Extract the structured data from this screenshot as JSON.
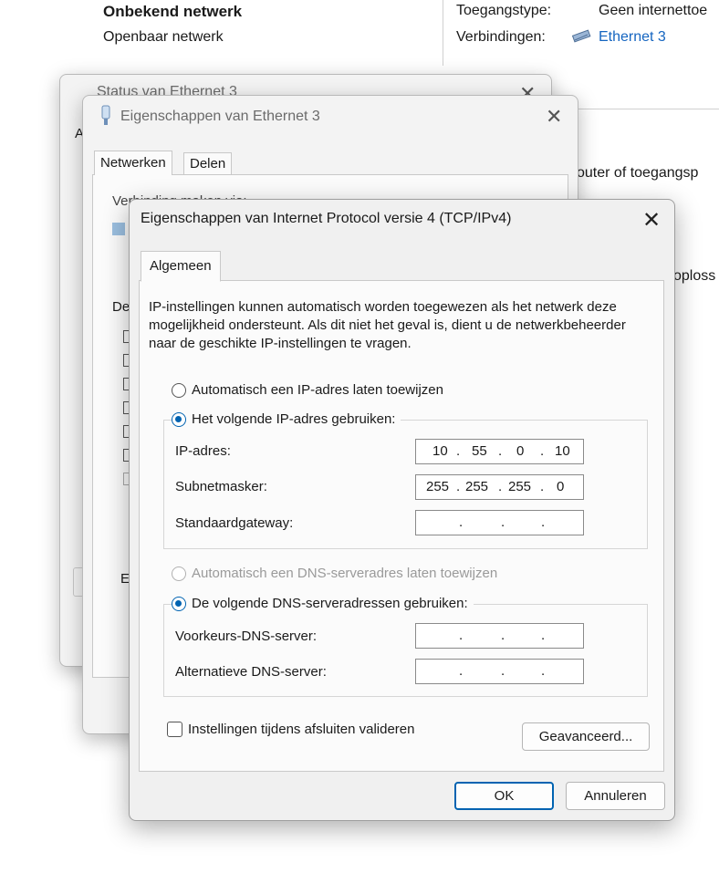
{
  "background": {
    "network_name": "Onbekend netwerk",
    "network_type": "Openbaar netwerk",
    "access_type_label": "Toegangstype:",
    "access_type_value": "Geen internettoe",
    "connections_label": "Verbindingen:",
    "connections_value": "Ethernet 3",
    "partial_text_1": "outer of toegangsp",
    "partial_text_2": "oploss"
  },
  "status_window": {
    "title": "Status van Ethernet 3",
    "partial_letter": "A"
  },
  "properties_window": {
    "title": "Eigenschappen van Ethernet 3",
    "tabs": [
      "Netwerken",
      "Delen"
    ],
    "connect_via_label": "Verbinding maken via:",
    "partial_label_de": "De",
    "partial_label_e": "E"
  },
  "ipv4_dialog": {
    "title": "Eigenschappen van Internet Protocol versie 4 (TCP/IPv4)",
    "tab": "Algemeen",
    "intro": "IP-instellingen kunnen automatisch worden toegewezen als het netwerk deze mogelijkheid ondersteunt. Als dit niet het geval is, dient u de netwerkbeheerder naar de geschikte IP-instellingen te vragen.",
    "auto_ip_label": "Automatisch een IP-adres laten toewijzen",
    "manual_ip_label": "Het volgende IP-adres gebruiken:",
    "ip_address_label": "IP-adres:",
    "ip_address": [
      "10",
      "55",
      "0",
      "10"
    ],
    "subnet_label": "Subnetmasker:",
    "subnet": [
      "255",
      "255",
      "255",
      "0"
    ],
    "gateway_label": "Standaardgateway:",
    "gateway": [
      "",
      "",
      "",
      ""
    ],
    "auto_dns_label": "Automatisch een DNS-serveradres laten toewijzen",
    "manual_dns_label": "De volgende DNS-serveradressen gebruiken:",
    "preferred_dns_label": "Voorkeurs-DNS-server:",
    "preferred_dns": [
      "",
      "",
      "",
      ""
    ],
    "alternate_dns_label": "Alternatieve DNS-server:",
    "alternate_dns": [
      "",
      "",
      "",
      ""
    ],
    "validate_label": "Instellingen tijdens afsluiten valideren",
    "advanced_button": "Geavanceerd...",
    "ok_button": "OK",
    "cancel_button": "Annuleren"
  }
}
